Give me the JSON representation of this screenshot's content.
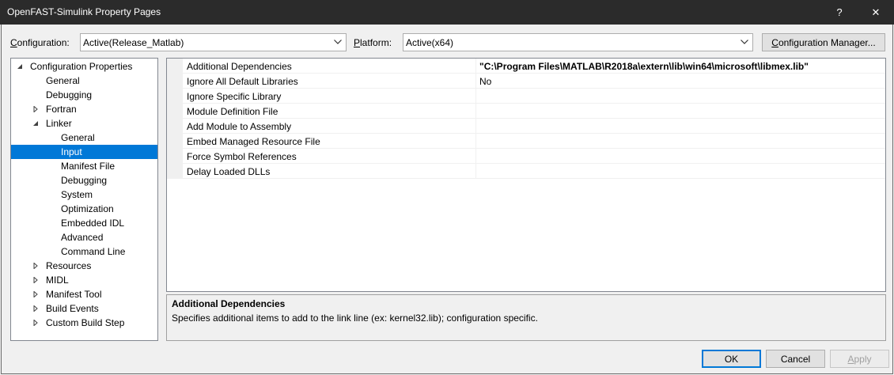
{
  "window": {
    "title": "OpenFAST-Simulink Property Pages",
    "help_label": "?",
    "close_label": "✕"
  },
  "config": {
    "label_prefix": "C",
    "label_rest": "onfiguration:",
    "value": "Active(Release_Matlab)",
    "platform_label_prefix": "P",
    "platform_label_rest": "latform:",
    "platform_value": "Active(x64)",
    "manager_label_prefix": "C",
    "manager_label_rest": "onfiguration Manager..."
  },
  "tree": {
    "nodes": [
      {
        "label": "Configuration Properties",
        "level": 0,
        "expander": "expanded",
        "selected": false
      },
      {
        "label": "General",
        "level": 1,
        "expander": "none",
        "selected": false
      },
      {
        "label": "Debugging",
        "level": 1,
        "expander": "none",
        "selected": false
      },
      {
        "label": "Fortran",
        "level": 1,
        "expander": "collapsed",
        "selected": false
      },
      {
        "label": "Linker",
        "level": 1,
        "expander": "expanded",
        "selected": false
      },
      {
        "label": "General",
        "level": 2,
        "expander": "none",
        "selected": false
      },
      {
        "label": "Input",
        "level": 2,
        "expander": "none",
        "selected": true
      },
      {
        "label": "Manifest File",
        "level": 2,
        "expander": "none",
        "selected": false
      },
      {
        "label": "Debugging",
        "level": 2,
        "expander": "none",
        "selected": false
      },
      {
        "label": "System",
        "level": 2,
        "expander": "none",
        "selected": false
      },
      {
        "label": "Optimization",
        "level": 2,
        "expander": "none",
        "selected": false
      },
      {
        "label": "Embedded IDL",
        "level": 2,
        "expander": "none",
        "selected": false
      },
      {
        "label": "Advanced",
        "level": 2,
        "expander": "none",
        "selected": false
      },
      {
        "label": "Command Line",
        "level": 2,
        "expander": "none",
        "selected": false
      },
      {
        "label": "Resources",
        "level": 1,
        "expander": "collapsed",
        "selected": false
      },
      {
        "label": "MIDL",
        "level": 1,
        "expander": "collapsed",
        "selected": false
      },
      {
        "label": "Manifest Tool",
        "level": 1,
        "expander": "collapsed",
        "selected": false
      },
      {
        "label": "Build Events",
        "level": 1,
        "expander": "collapsed",
        "selected": false
      },
      {
        "label": "Custom Build Step",
        "level": 1,
        "expander": "collapsed",
        "selected": false
      }
    ]
  },
  "properties": {
    "rows": [
      {
        "name": "Additional Dependencies",
        "value": "\"C:\\Program Files\\MATLAB\\R2018a\\extern\\lib\\win64\\microsoft\\libmex.lib\"",
        "bold": true
      },
      {
        "name": "Ignore All Default Libraries",
        "value": "No",
        "bold": false
      },
      {
        "name": "Ignore Specific Library",
        "value": "",
        "bold": false
      },
      {
        "name": "Module Definition File",
        "value": "",
        "bold": false
      },
      {
        "name": "Add Module to Assembly",
        "value": "",
        "bold": false
      },
      {
        "name": "Embed Managed Resource File",
        "value": "",
        "bold": false
      },
      {
        "name": "Force Symbol References",
        "value": "",
        "bold": false
      },
      {
        "name": "Delay Loaded DLLs",
        "value": "",
        "bold": false
      }
    ]
  },
  "description": {
    "title": "Additional Dependencies",
    "text": "Specifies additional items to add to the link line (ex: kernel32.lib); configuration specific."
  },
  "buttons": {
    "ok": "OK",
    "cancel": "Cancel",
    "apply_prefix": "A",
    "apply_rest": "pply"
  },
  "colors": {
    "titlebar": "#2b2b2b",
    "selection": "#0078d7"
  }
}
